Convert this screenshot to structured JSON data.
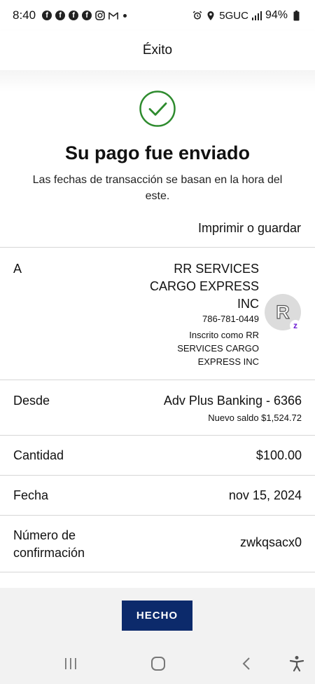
{
  "status_bar": {
    "time": "8:40",
    "network": "5GUC",
    "battery": "94%"
  },
  "header": {
    "title": "Éxito"
  },
  "success": {
    "title": "Su pago fue enviado",
    "subtitle": "Las fechas de transacción se basan en la hora del este.",
    "print_label": "Imprimir o guardar",
    "check_color": "#2e8b2e"
  },
  "recipient": {
    "label": "A",
    "name": "RR SERVICES CARGO EXPRESS INC",
    "phone": "786-781-0449",
    "enrolled": "Inscrito como RR SERVICES CARGO EXPRESS INC",
    "avatar_initial": "R",
    "badge": "z"
  },
  "from": {
    "label": "Desde",
    "account": "Adv Plus Banking - 6366",
    "balance": "Nuevo saldo $1,524.72"
  },
  "amount": {
    "label": "Cantidad",
    "value": "$100.00"
  },
  "date": {
    "label": "Fecha",
    "value": "nov 15, 2024"
  },
  "confirmation": {
    "label": "Número de confirmación",
    "value": "zwkqsacx0"
  },
  "actions": {
    "done_label": "HECHO",
    "button_color": "#0c2a6b"
  },
  "nav": {
    "recents": "recents-icon",
    "home": "home-icon",
    "back": "back-icon",
    "accessibility": "accessibility-icon"
  }
}
